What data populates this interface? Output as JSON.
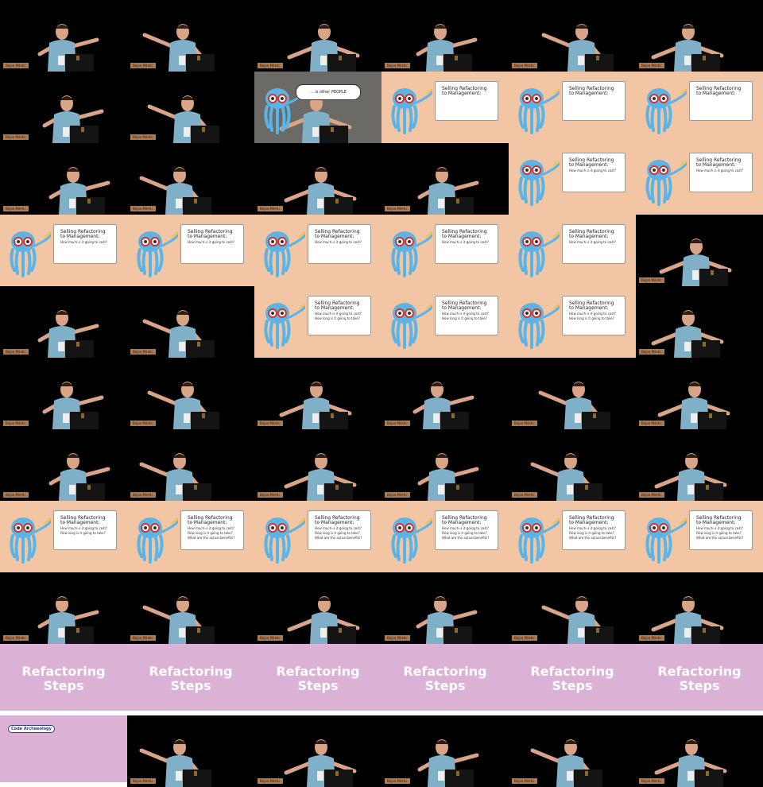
{
  "caption": "Bojan Miletic",
  "slide": {
    "title_line1": "Selling Refactoring",
    "title_line2": "to Management:",
    "q1": "How much is it going to cost?",
    "q2": "How long is it going to take?",
    "q3": "What are the actual benefits?"
  },
  "section_title_line1": "Refactoring",
  "section_title_line2": "Steps",
  "code_tag": "Code Archaeology",
  "bubble_text": "... is other PEOPLE",
  "colors": {
    "peach": "#f2c6a4",
    "purple": "#dcb1d6",
    "shirt": "#7fb0c8",
    "octopus": "#5ab4e6",
    "glasses": "#d8332a"
  },
  "cells": [
    "speaker",
    "speaker",
    "speaker",
    "speaker",
    "speaker",
    "speaker",
    "speaker",
    "speaker",
    "bubble",
    "slide0",
    "slide0",
    "slide0",
    "speaker",
    "speaker",
    "speaker",
    "speaker",
    "slide1",
    "slide1",
    "slide1",
    "slide1",
    "slide1",
    "slide1",
    "slide1",
    "speaker",
    "speaker",
    "speaker",
    "slide2",
    "slide2",
    "slide2",
    "speaker",
    "speaker",
    "speaker",
    "speaker",
    "speaker",
    "speaker",
    "speaker",
    "speaker",
    "speaker",
    "speaker",
    "speaker",
    "speaker",
    "speaker",
    "slide2",
    "slide3",
    "slide3",
    "slide3",
    "slide3",
    "slide3",
    "speaker",
    "speaker",
    "speaker",
    "speaker",
    "speaker",
    "speaker",
    "section",
    "section",
    "section",
    "section",
    "section",
    "section",
    "code",
    "speaker",
    "speaker",
    "speaker",
    "speaker",
    "speaker"
  ]
}
